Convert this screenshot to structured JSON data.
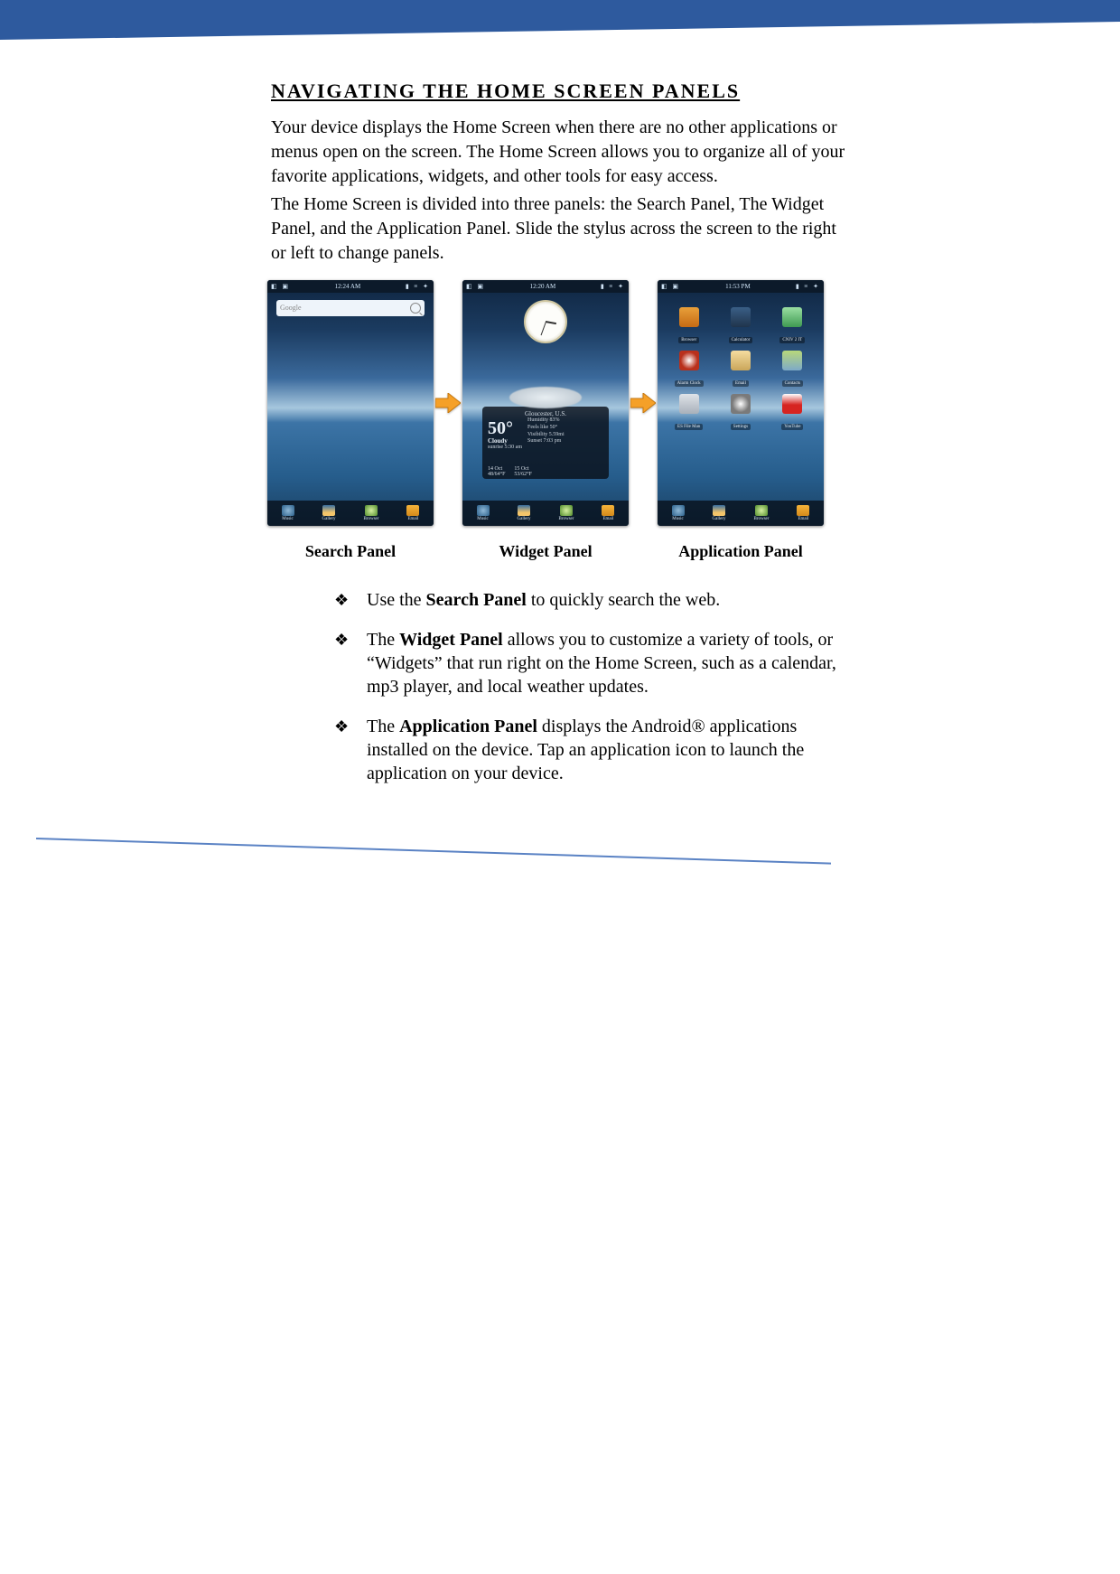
{
  "heading": "NAVIGATING THE HOME SCREEN PANELS",
  "para1": "Your device displays the Home Screen when there are no other applications or menus open on the screen. The Home Screen allows you to organize all of your favorite applications, widgets, and other tools for easy access.",
  "para2": "The Home Screen is divided into three panels: the Search Panel, The Widget Panel, and the Application Panel. Slide the stylus across the screen to the right or left to change panels.",
  "captions": {
    "search": "Search Panel",
    "widget": "Widget Panel",
    "app": "Application Panel"
  },
  "status": {
    "time_search": "12:24 AM",
    "time_widget": "12:20 AM",
    "time_app": "11:53 PM"
  },
  "search": {
    "placeholder": "Google"
  },
  "weather": {
    "location": "Gloucester, U.S.",
    "temp": "50°",
    "condition": "Cloudy",
    "sun": "sunrise 5:30 am",
    "forecast": [
      {
        "day": "14 Oct",
        "vals": "48/64°F"
      },
      {
        "day": "15 Oct",
        "vals": "53/62°F"
      }
    ],
    "detail_lines": [
      "Humidity 83%",
      "Feels like 50°",
      "Visibility 5.59mi",
      "Sunset  7:03 pm"
    ]
  },
  "apps": [
    {
      "name": "Browser",
      "color": "linear-gradient(#e8a03a,#c56a14)"
    },
    {
      "name": "Calculator",
      "color": "linear-gradient(#3a5f86,#20344c)"
    },
    {
      "name": "CNIV 2 IT",
      "color": "linear-gradient(#9adfa2,#3f9a52)"
    },
    {
      "name": "Alarm Clock",
      "color": "radial-gradient(circle,#fff,#b9301c 60%)"
    },
    {
      "name": "Email",
      "color": "linear-gradient(#f5dca0,#caa65a)"
    },
    {
      "name": "Contacts",
      "color": "linear-gradient(#b8d87a,#7daac8)"
    },
    {
      "name": "ES File Man",
      "color": "linear-gradient(#dfe3e8,#a8b0ba)"
    },
    {
      "name": "Settings",
      "color": "radial-gradient(circle,#fff,#7a7a7a 60%)"
    },
    {
      "name": "YouTube",
      "color": "linear-gradient(#fff,#d62421 55%)"
    }
  ],
  "dock": {
    "items": [
      "Music",
      "Gallery",
      "Browser",
      "Email"
    ]
  },
  "bullets": [
    {
      "prefix": "Use the ",
      "bold": "Search Panel",
      "rest": " to quickly search the web."
    },
    {
      "prefix": "The ",
      "bold": "Widget Panel",
      "rest": " allows you to customize a variety of tools, or “Widgets” that run right on the Home Screen, such as a calendar, mp3 player, and local weather updates."
    },
    {
      "prefix": "The ",
      "bold": "Application Panel",
      "rest": " displays the Android® applications installed on the device. Tap an application icon to launch the application on your device."
    }
  ]
}
